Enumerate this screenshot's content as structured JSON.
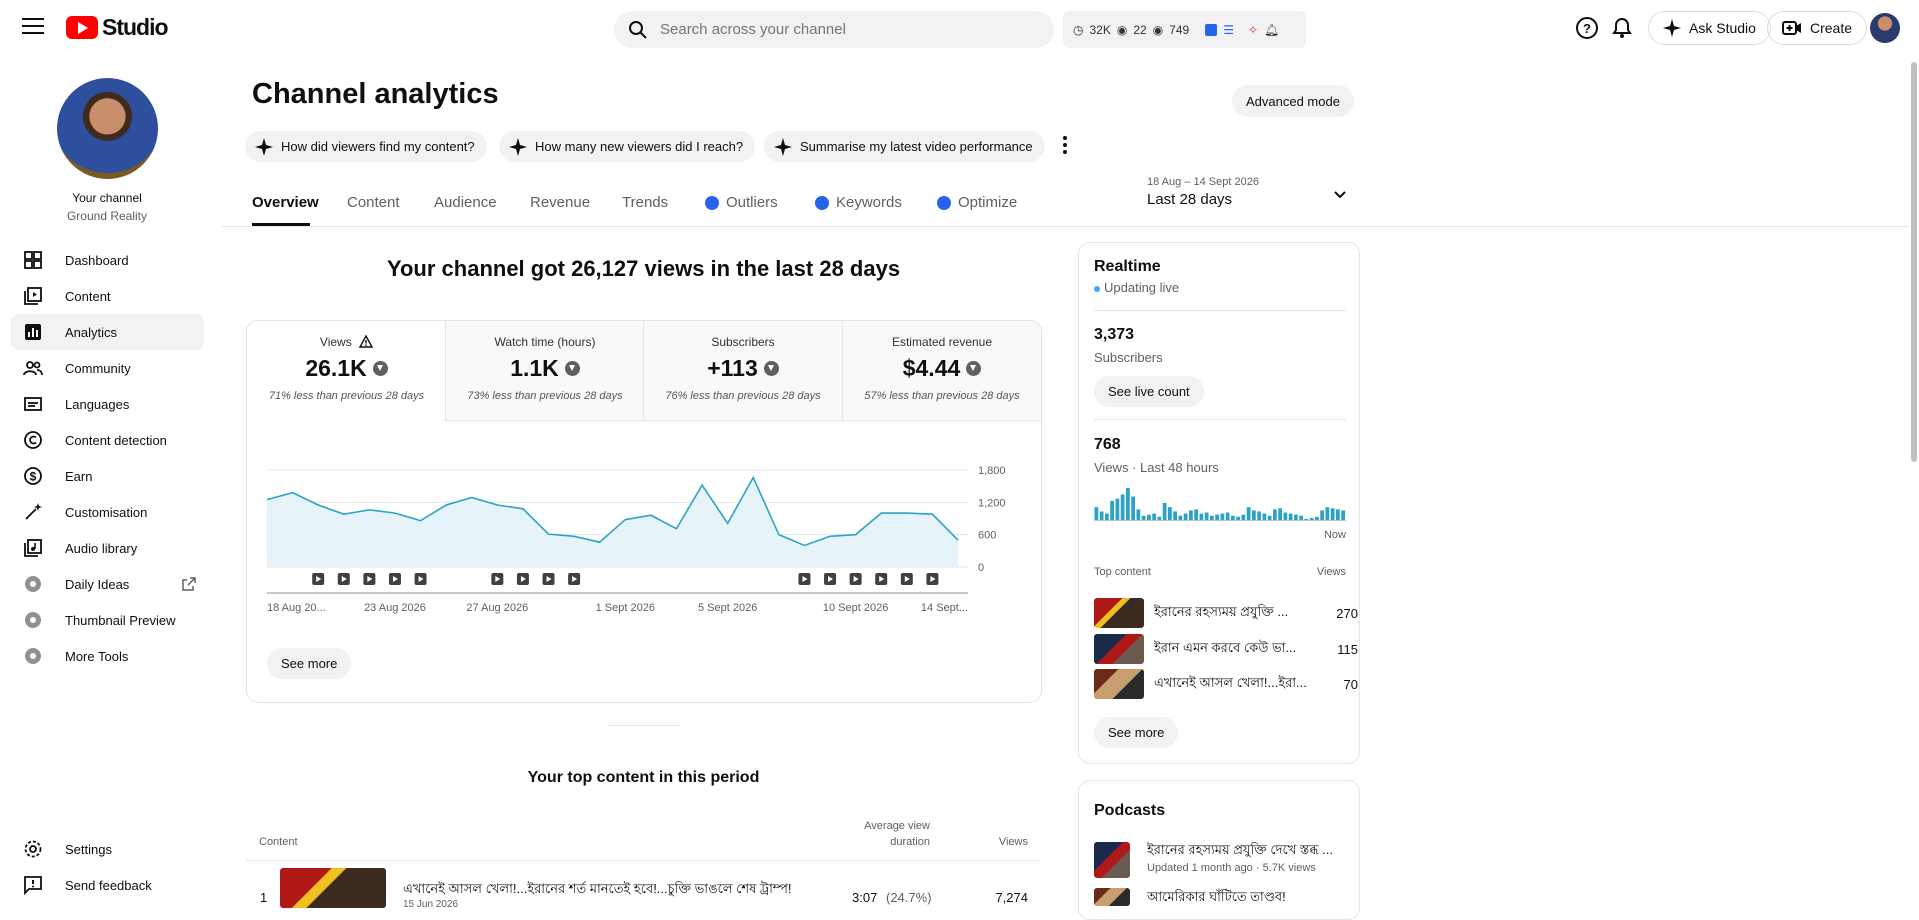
{
  "header": {
    "logo_text": "Studio",
    "search_placeholder": "Search across your channel",
    "stats": {
      "watch": "32K",
      "views_a": "22",
      "views_b": "749"
    },
    "ask_label": "Ask Studio",
    "create_label": "Create"
  },
  "sidebar": {
    "channel_label": "Your channel",
    "channel_name": "Ground Reality",
    "items": [
      {
        "label": "Dashboard",
        "icon": "dashboard-icon"
      },
      {
        "label": "Content",
        "icon": "content-icon"
      },
      {
        "label": "Analytics",
        "icon": "analytics-icon"
      },
      {
        "label": "Community",
        "icon": "community-icon"
      },
      {
        "label": "Languages",
        "icon": "languages-icon"
      },
      {
        "label": "Content detection",
        "icon": "copyright-icon"
      },
      {
        "label": "Earn",
        "icon": "dollar-icon"
      },
      {
        "label": "Customisation",
        "icon": "wand-icon"
      },
      {
        "label": "Audio library",
        "icon": "music-library-icon"
      },
      {
        "label": "Daily Ideas",
        "icon": "extension-icon"
      },
      {
        "label": "Thumbnail Preview",
        "icon": "extension-icon"
      },
      {
        "label": "More Tools",
        "icon": "extension-icon"
      }
    ],
    "settings": "Settings",
    "feedback": "Send feedback"
  },
  "main": {
    "title": "Channel analytics",
    "advanced_mode": "Advanced mode",
    "chips": [
      "How did viewers find my content?",
      "How many new viewers did I reach?",
      "Summarise my latest video performance"
    ],
    "tabs": [
      "Overview",
      "Content",
      "Audience",
      "Revenue",
      "Trends",
      "Outliers",
      "Keywords",
      "Optimize"
    ],
    "date_range": {
      "dates": "18 Aug – 14 Sept 2026",
      "label": "Last 28 days"
    },
    "headline": "Your channel got 26,127 views in the last 28 days",
    "metrics": [
      {
        "label": "Views",
        "value": "26.1K",
        "compare": "71% less than previous 28 days"
      },
      {
        "label": "Watch time (hours)",
        "value": "1.1K",
        "compare": "73% less than previous 28 days"
      },
      {
        "label": "Subscribers",
        "value": "+113",
        "compare": "76% less than previous 28 days"
      },
      {
        "label": "Estimated revenue",
        "value": "$4.44",
        "compare": "57% less than previous 28 days"
      }
    ],
    "see_more": "See more",
    "top_content_title": "Your top content in this period",
    "table": {
      "col_content": "Content",
      "col_avd_1": "Average view",
      "col_avd_2": "duration",
      "col_views": "Views",
      "rows": [
        {
          "rank": "1",
          "title": "এখানেই আসল খেলা!...ইরানের শর্ত মানতেই হবে!...চুক্তি ভাঙলে শেষ ট্রাম্প!",
          "date": "15 Jun 2026",
          "avd": "3:07",
          "avd_pct": "(24.7%)",
          "views": "7,274"
        }
      ]
    }
  },
  "chart_data": {
    "type": "line",
    "x": [
      "18 Aug",
      "19 Aug",
      "20 Aug",
      "21 Aug",
      "22 Aug",
      "23 Aug",
      "24 Aug",
      "25 Aug",
      "26 Aug",
      "27 Aug",
      "28 Aug",
      "29 Aug",
      "30 Aug",
      "31 Aug",
      "1 Sept",
      "2 Sept",
      "3 Sept",
      "4 Sept",
      "5 Sept",
      "6 Sept",
      "7 Sept",
      "8 Sept",
      "9 Sept",
      "10 Sept",
      "11 Sept",
      "12 Sept",
      "13 Sept",
      "14 Sept"
    ],
    "values": [
      1250,
      1380,
      1150,
      980,
      1060,
      1000,
      860,
      1150,
      1290,
      1150,
      1080,
      610,
      570,
      460,
      880,
      960,
      710,
      1520,
      810,
      1660,
      600,
      400,
      570,
      600,
      1000,
      1000,
      980,
      500
    ],
    "x_tick_labels": [
      "18 Aug 20...",
      "23 Aug 2026",
      "27 Aug 2026",
      "1 Sept 2026",
      "5 Sept 2026",
      "10 Sept 2026",
      "14 Sept..."
    ],
    "y_ticks": [
      "0",
      "600",
      "1,200",
      "1,800"
    ],
    "ylim": [
      0,
      1800
    ],
    "color": "#2ba3c6",
    "fill": "#e6f3f8",
    "video_markers": [
      2,
      3,
      4,
      5,
      6,
      9,
      10,
      11,
      12,
      21,
      22,
      23,
      24,
      25,
      26
    ]
  },
  "realtime": {
    "title": "Realtime",
    "status": "Updating live",
    "subscribers": "3,373",
    "subscribers_label": "Subscribers",
    "see_live": "See live count",
    "views": "768",
    "views_label": "Views · Last 48 hours",
    "now_label": "Now",
    "top_content_label": "Top content",
    "views_col": "Views",
    "bars": [
      12,
      8,
      6,
      18,
      20,
      24,
      30,
      22,
      10,
      4,
      5,
      6,
      3,
      16,
      12,
      8,
      4,
      6,
      9,
      10,
      6,
      7,
      4,
      5,
      6,
      7,
      4,
      3,
      5,
      12,
      9,
      8,
      6,
      4,
      10,
      11,
      7,
      6,
      5,
      4,
      1,
      2,
      3,
      9,
      12,
      11,
      10,
      9
    ],
    "items": [
      {
        "title": "ইরানের রহস্যময় প্রযুক্তি ...",
        "views": "270"
      },
      {
        "title": "ইরান এমন করবে কেউ ভা...",
        "views": "115"
      },
      {
        "title": "এখানেই আসল খেলা!...ইরা...",
        "views": "70"
      }
    ],
    "see_more": "See more"
  },
  "podcasts": {
    "title": "Podcasts",
    "items": [
      {
        "title": "ইরানের রহস্যময় প্রযুক্তি দেখে স্তব্ধ ...",
        "meta": "Updated 1 month ago · 5.7K views"
      },
      {
        "title": "আমেরিকার ঘাঁটিতে তাণ্ডব!",
        "meta": ""
      }
    ]
  }
}
